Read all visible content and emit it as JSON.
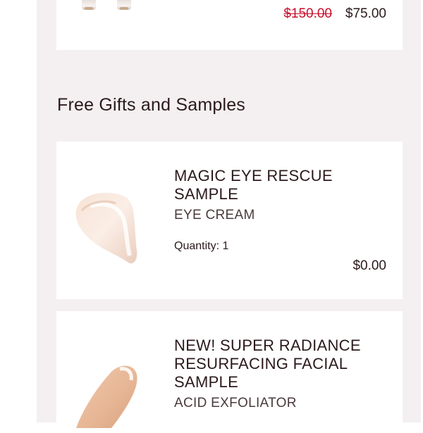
{
  "previous_item": {
    "price_original": "$150.00",
    "price_sale": "$75.00",
    "price_original_color": "#c8102e"
  },
  "section": {
    "title": "Free Gifts and Samples"
  },
  "gifts": [
    {
      "name": "MAGIC EYE RESCUE SAMPLE",
      "category": "EYE CREAM",
      "quantity": "Quantity: 1",
      "price": "$0.00",
      "image_icon": "cream-swatch-icon"
    },
    {
      "name": "NEW! SUPER RADIANCE RESURFACING FACIAL SAMPLE",
      "category": "ACID EXFOLIATOR",
      "image_icon": "cream-swatch-icon"
    }
  ],
  "colors": {
    "page_background": "#f4f0f1",
    "card_background": "#ffffff",
    "text": "#2b1a1c"
  }
}
